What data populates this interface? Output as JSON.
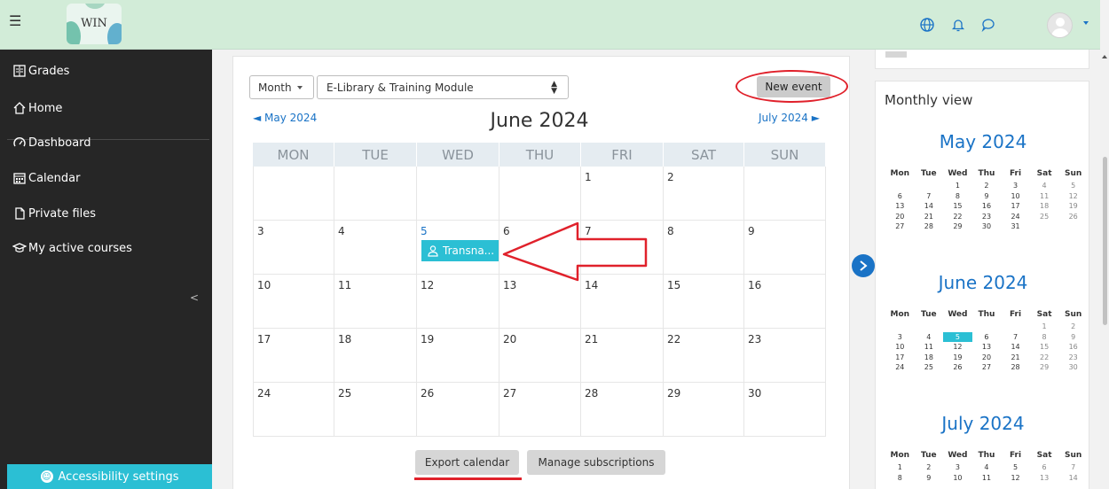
{
  "header": {
    "logo_text": "WIN"
  },
  "sidebar": {
    "items": [
      {
        "label": "Grades"
      },
      {
        "label": "Home"
      },
      {
        "label": "Dashboard"
      },
      {
        "label": "Calendar"
      },
      {
        "label": "Private files"
      },
      {
        "label": "My active courses"
      }
    ],
    "collapse_glyph": "<",
    "accessibility_label": "Accessibility settings"
  },
  "calendar": {
    "view_select": "Month",
    "course_select": "E-Library & Training Module",
    "new_event_label": "New event",
    "prev_month": "◄ May 2024",
    "next_month": "July 2024 ►",
    "current_month": "June 2024",
    "weekdays": [
      "MON",
      "TUE",
      "WED",
      "THU",
      "FRI",
      "SAT",
      "SUN"
    ],
    "weeks": [
      [
        "",
        "",
        "",
        "",
        "1",
        "2",
        ""
      ],
      [
        "3",
        "4",
        "5",
        "6",
        "7",
        "8",
        "9"
      ],
      [
        "10",
        "11",
        "12",
        "13",
        "14",
        "15",
        "16"
      ],
      [
        "17",
        "18",
        "19",
        "20",
        "21",
        "22",
        "23"
      ],
      [
        "24",
        "25",
        "26",
        "27",
        "28",
        "29",
        "30"
      ]
    ],
    "today": "5",
    "event_label": "Transna...",
    "export_label": "Export calendar",
    "manage_label": "Manage subscriptions"
  },
  "monthly_view": {
    "title": "Monthly view",
    "headers": [
      "Mon",
      "Tue",
      "Wed",
      "Thu",
      "Fri",
      "Sat",
      "Sun"
    ],
    "months": [
      {
        "name": "May 2024",
        "weeks": [
          [
            "",
            "",
            "1",
            "2",
            "3",
            "4",
            "5"
          ],
          [
            "6",
            "7",
            "8",
            "9",
            "10",
            "11",
            "12"
          ],
          [
            "13",
            "14",
            "15",
            "16",
            "17",
            "18",
            "19"
          ],
          [
            "20",
            "21",
            "22",
            "23",
            "24",
            "25",
            "26"
          ],
          [
            "27",
            "28",
            "29",
            "30",
            "31",
            "",
            ""
          ]
        ]
      },
      {
        "name": "June 2024",
        "weeks": [
          [
            "",
            "",
            "",
            "",
            "",
            "1",
            "2"
          ],
          [
            "3",
            "4",
            "5",
            "6",
            "7",
            "8",
            "9"
          ],
          [
            "10",
            "11",
            "12",
            "13",
            "14",
            "15",
            "16"
          ],
          [
            "17",
            "18",
            "19",
            "20",
            "21",
            "22",
            "23"
          ],
          [
            "24",
            "25",
            "26",
            "27",
            "28",
            "29",
            "30"
          ]
        ]
      },
      {
        "name": "July 2024",
        "weeks": [
          [
            "1",
            "2",
            "3",
            "4",
            "5",
            "6",
            "7"
          ],
          [
            "8",
            "9",
            "10",
            "11",
            "12",
            "13",
            "14"
          ]
        ]
      }
    ]
  },
  "colors": {
    "accent": "#1a73c6",
    "event": "#2bbfd4",
    "annotation": "#e0212b",
    "sidebar": "#262626",
    "topbar": "#d2ecd8"
  },
  "icons": [
    "menu-icon",
    "globe-icon",
    "bell-icon",
    "chat-icon",
    "user-avatar",
    "grades-icon",
    "home-icon",
    "dashboard-icon",
    "calendar-icon",
    "files-icon",
    "courses-icon",
    "accessibility-icon",
    "user-icon",
    "chevron-right-icon"
  ]
}
